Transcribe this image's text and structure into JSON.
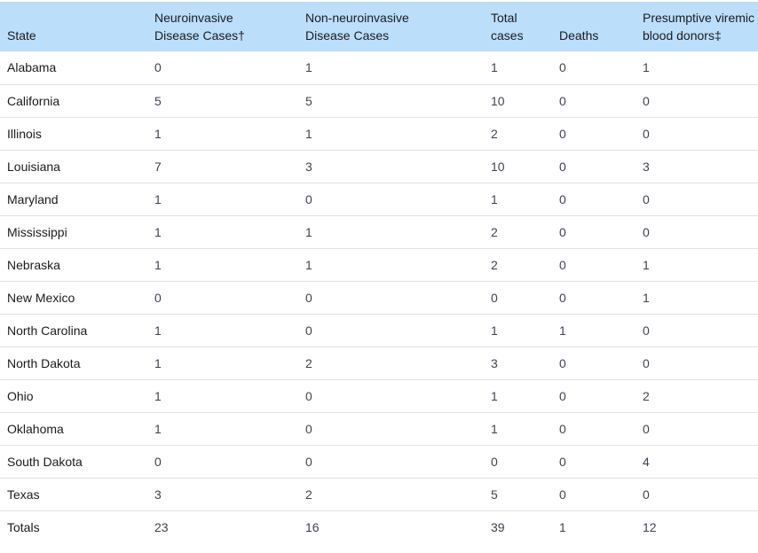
{
  "table": {
    "headers": {
      "state": "State",
      "neuro_line1": "Neuroinvasive",
      "neuro_line2": "Disease Cases†",
      "nonneuro_line1": "Non-neuroinvasive",
      "nonneuro_line2": "Disease Cases",
      "total_line1": "Total",
      "total_line2": "cases",
      "deaths": "Deaths",
      "donors_line1": "Presumptive viremic",
      "donors_line2": "blood donors‡"
    },
    "rows": [
      {
        "state": "Alabama",
        "neuro": "0",
        "nonneuro": "1",
        "total": "1",
        "deaths": "0",
        "donors": "1"
      },
      {
        "state": "California",
        "neuro": "5",
        "nonneuro": "5",
        "total": "10",
        "deaths": "0",
        "donors": "0"
      },
      {
        "state": "Illinois",
        "neuro": "1",
        "nonneuro": "1",
        "total": "2",
        "deaths": "0",
        "donors": "0"
      },
      {
        "state": "Louisiana",
        "neuro": "7",
        "nonneuro": "3",
        "total": "10",
        "deaths": "0",
        "donors": "3"
      },
      {
        "state": "Maryland",
        "neuro": "1",
        "nonneuro": "0",
        "total": "1",
        "deaths": "0",
        "donors": "0"
      },
      {
        "state": "Mississippi",
        "neuro": "1",
        "nonneuro": "1",
        "total": "2",
        "deaths": "0",
        "donors": "0"
      },
      {
        "state": "Nebraska",
        "neuro": "1",
        "nonneuro": "1",
        "total": "2",
        "deaths": "0",
        "donors": "1"
      },
      {
        "state": "New Mexico",
        "neuro": "0",
        "nonneuro": "0",
        "total": "0",
        "deaths": "0",
        "donors": "1"
      },
      {
        "state": "North Carolina",
        "neuro": "1",
        "nonneuro": "0",
        "total": "1",
        "deaths": "1",
        "donors": "0"
      },
      {
        "state": "North Dakota",
        "neuro": "1",
        "nonneuro": "2",
        "total": "3",
        "deaths": "0",
        "donors": "0"
      },
      {
        "state": "Ohio",
        "neuro": "1",
        "nonneuro": "0",
        "total": "1",
        "deaths": "0",
        "donors": "2"
      },
      {
        "state": "Oklahoma",
        "neuro": "1",
        "nonneuro": "0",
        "total": "1",
        "deaths": "0",
        "donors": "0"
      },
      {
        "state": "South Dakota",
        "neuro": "0",
        "nonneuro": "0",
        "total": "0",
        "deaths": "0",
        "donors": "4"
      },
      {
        "state": "Texas",
        "neuro": "3",
        "nonneuro": "2",
        "total": "5",
        "deaths": "0",
        "donors": "0"
      },
      {
        "state": "Totals",
        "neuro": "23",
        "nonneuro": "16",
        "total": "39",
        "deaths": "1",
        "donors": "12"
      }
    ]
  },
  "colors": {
    "header_bg": "#bbdefb",
    "row_divider": "#dfe1e2"
  }
}
